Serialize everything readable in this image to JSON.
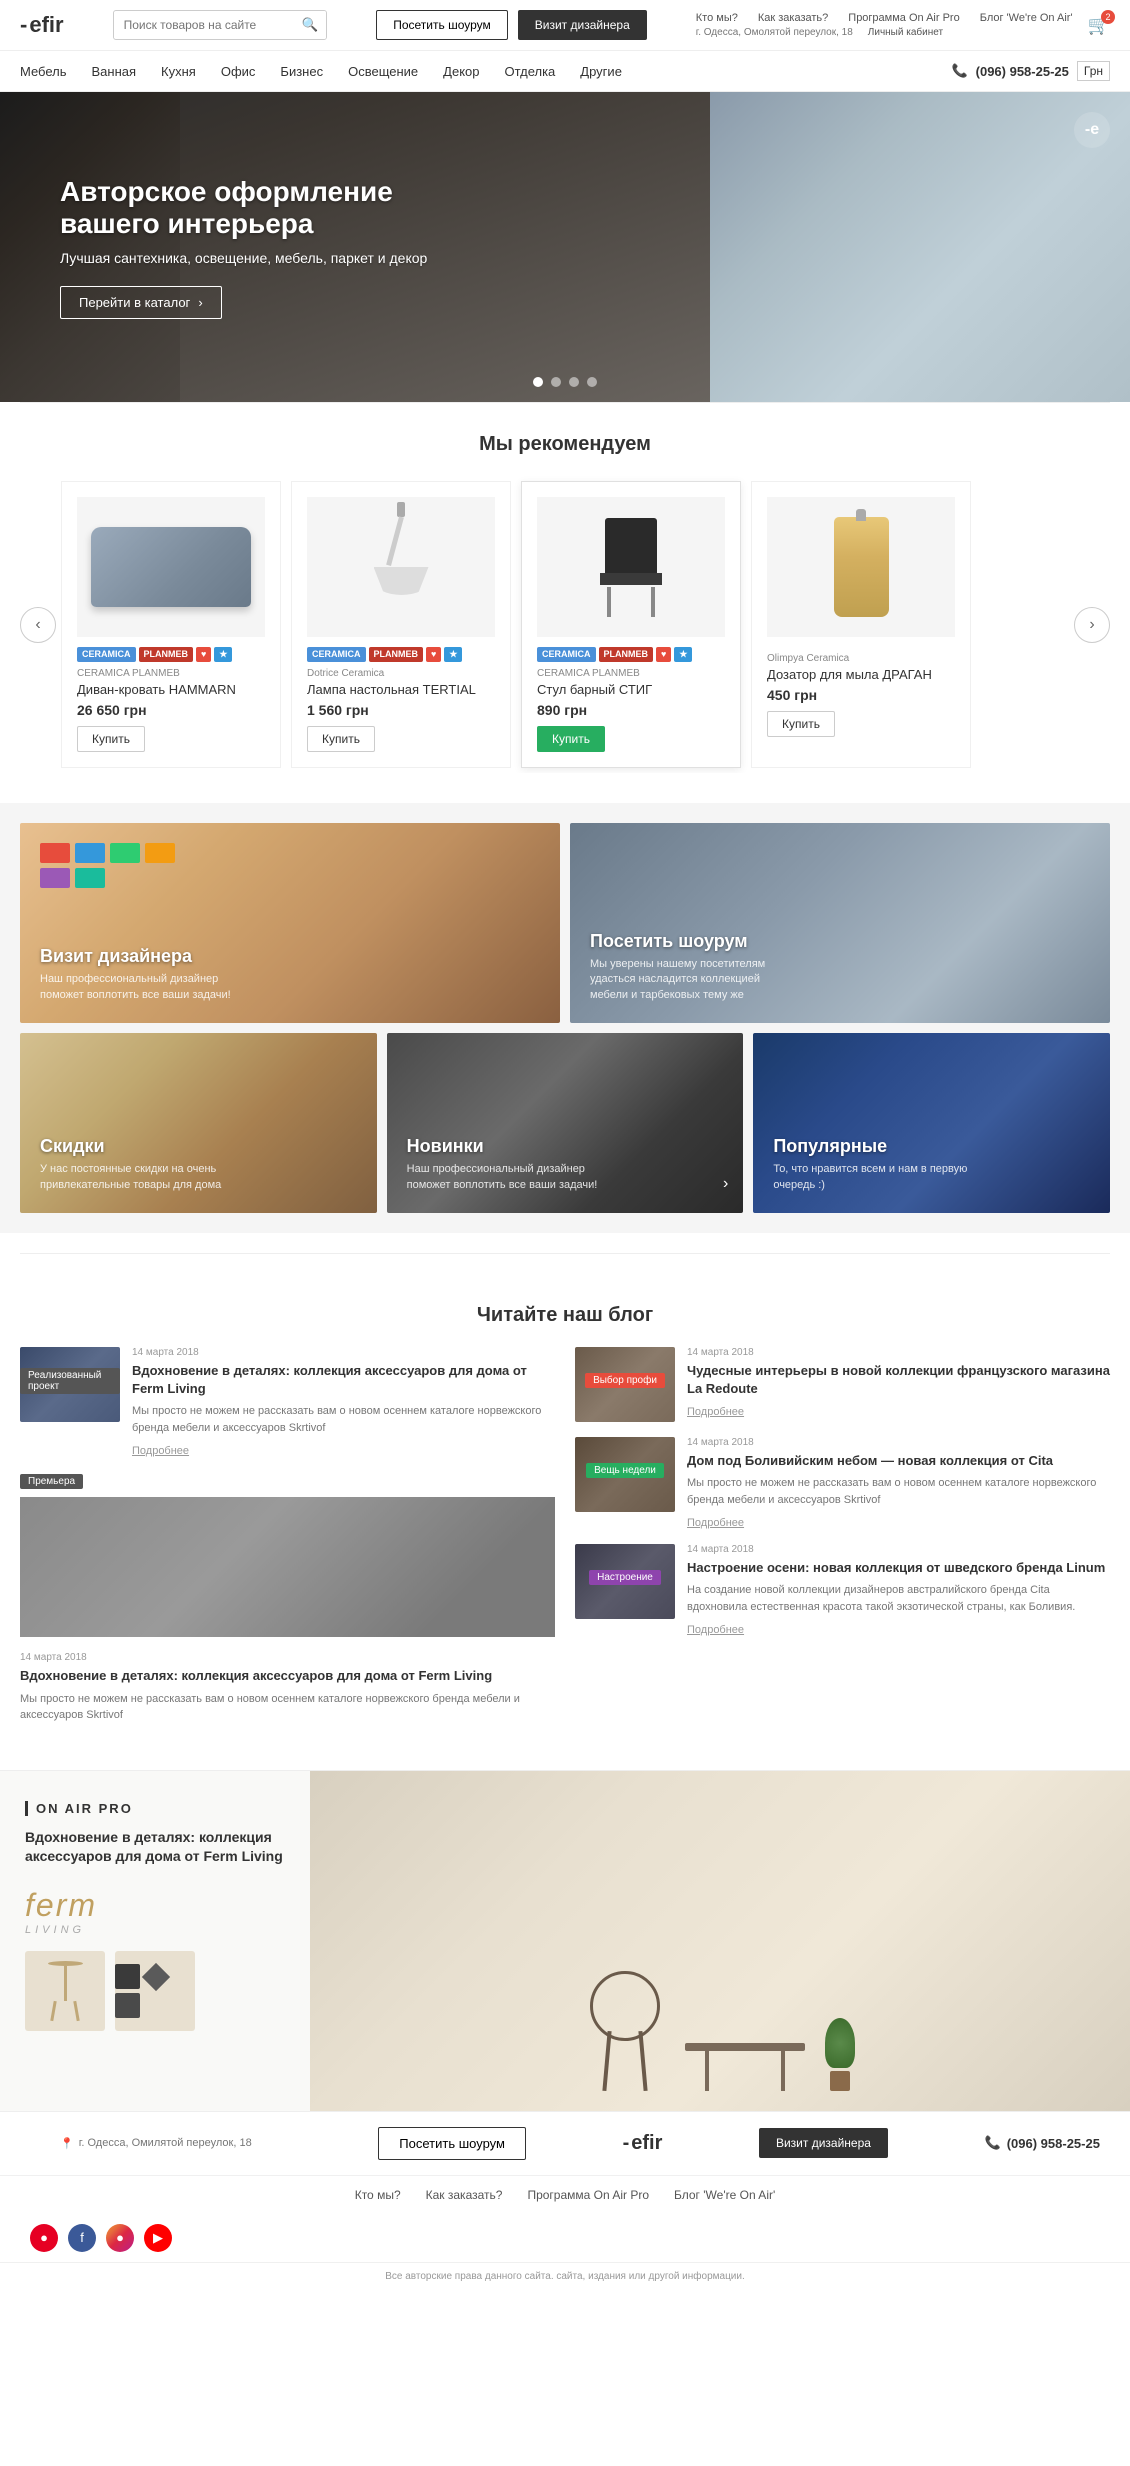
{
  "header": {
    "logo": "efir",
    "search_placeholder": "Поиск товаров на сайте",
    "btn_showroom": "Посетить шоурум",
    "btn_designer": "Визит дизайнера",
    "links": [
      "Кто мы?",
      "Как заказать?",
      "Программа On Air Pro",
      "Блог 'We're On Air'"
    ],
    "address": "г. Одесса, Омолятой переулок, 18",
    "account": "Личный кабинет",
    "cart_count": "2"
  },
  "nav": {
    "items": [
      "Мебель",
      "Ванная",
      "Кухня",
      "Офис",
      "Бизнес",
      "Освещение",
      "Декор",
      "Отделка",
      "Другие"
    ],
    "phone": "(096) 958-25-25",
    "currency": "Грн"
  },
  "hero": {
    "title": "Авторское оформление вашего интерьера",
    "subtitle": "Лучшая сантехника, освещение, мебель, паркет и декор",
    "btn_catalog": "Перейти в каталог",
    "dots": 4,
    "active_dot": 0
  },
  "recommendations": {
    "section_title": "Мы рекомендуем",
    "products": [
      {
        "vendor": "CERAMICA PLANMEB",
        "name": "Диван-кровать HAMMARN",
        "price": "26 650 грн",
        "btn": "Купить",
        "badges": [
          "CERAMICA",
          "PLANMEB",
          "♥",
          "🔖"
        ]
      },
      {
        "vendor": "Dotrice Ceramica",
        "name": "Лампа настольная TERTIAL",
        "price": "1 560 грн",
        "btn": "Купить",
        "badges": [
          "CERAMICA",
          "PLANMEB",
          "♥",
          "🔖"
        ]
      },
      {
        "vendor": "CERAMICA PLANMEB",
        "name": "Стул барный СТИГ",
        "price": "890 грн",
        "btn": "Купить",
        "badges": [
          "CERAMICA",
          "PLANMEB",
          "♥",
          "🔖"
        ],
        "featured": true
      },
      {
        "vendor": "Olimpya Ceramica",
        "name": "Дозатор для мыла ДРАГАН",
        "price": "450 грн",
        "btn": "Купить",
        "badges": []
      }
    ]
  },
  "promo": {
    "cards_top": [
      {
        "title": "Визит дизайнера",
        "desc": "Наш профессиональный дизайнер поможет воплотить все ваши задачи!"
      },
      {
        "title": "Посетить шоурум",
        "desc": "Мы уверены нашему посетителям удасться насладится коллекцией мебели и тарбековых тему же"
      }
    ],
    "cards_bottom": [
      {
        "title": "Скидки",
        "desc": "У нас постоянные скидки на очень привлекательные товары для дома"
      },
      {
        "title": "Новинки",
        "desc": "Наш профессиональный дизайнер поможет воплотить все ваши задачи!"
      },
      {
        "title": "Популярные",
        "desc": "То, что нравится всем и нам в первую очередь :)"
      }
    ]
  },
  "blog": {
    "section_title": "Читайте наш блог",
    "posts": [
      {
        "date": "14 марта 2018",
        "badge": "Реализованный проект",
        "title": "Вдохновение в деталях: коллекция аксессуаров для дома от Ferm Living",
        "excerpt": "Мы просто не можем не рассказать вам о новом осеннем каталоге норвежского бренда мебели и аксессуаров Skrtivof",
        "more": "Подробнее"
      },
      {
        "date": "14 марта 2018",
        "badge": "Выбор профи",
        "title": "Чудесные интерьеры в новой коллекции французского магазина La Redoute",
        "excerpt": "",
        "more": "Подробнее"
      },
      {
        "date": "14 марта 2018",
        "badge": "Премьера",
        "title": "",
        "excerpt": "",
        "more": ""
      },
      {
        "date": "14 марта 2018",
        "badge": "Вещь недели",
        "title": "Дом под Боливийским небом — новая коллекция от Cita",
        "excerpt": "Мы просто не можем не рассказать вам о новом осеннем каталоге норвежского бренда мебели и аксессуаров Skrtivof",
        "more": "Подробнее"
      },
      {
        "date": "14 марта 2018",
        "badge": "Настроение",
        "title": "Настроение осени: новая коллекция от шведского бренда Linum",
        "excerpt": "На создание новой коллекции дизайнеров австралийского бренда Cita вдохновила естественная красота такой экзотической страны, как Боливия.",
        "more": "Подробнее"
      },
      {
        "date": "14 марта 2018",
        "badge": "",
        "title": "Вдохновение в деталях: коллекция аксессуаров для дома от Ferm Living",
        "excerpt": "Мы просто не можем не рассказать вам о новом осеннем каталоге норвежского бренда мебели и аксессуаров Skrtivof",
        "more": ""
      }
    ]
  },
  "on_air": {
    "tag": "ON AIR PRO",
    "title": "Вдохновение в деталях: коллекция аксессуаров для дома от Ferm Living",
    "brand": "ferm",
    "brand_sub": "LIVING"
  },
  "footer": {
    "btn_showroom": "Посетить шоурум",
    "btn_designer": "Визит дизайнера",
    "phone": "(096) 958-25-25",
    "address": "г. Одесса, Омилятой переулок, 18",
    "nav_links": [
      "Кто мы?",
      "Как заказать?",
      "Программа On Air Pro",
      "Блог 'We're On Air'"
    ],
    "copyright": "Все авторские права данного сайта. сайта, издания или другой информации."
  }
}
